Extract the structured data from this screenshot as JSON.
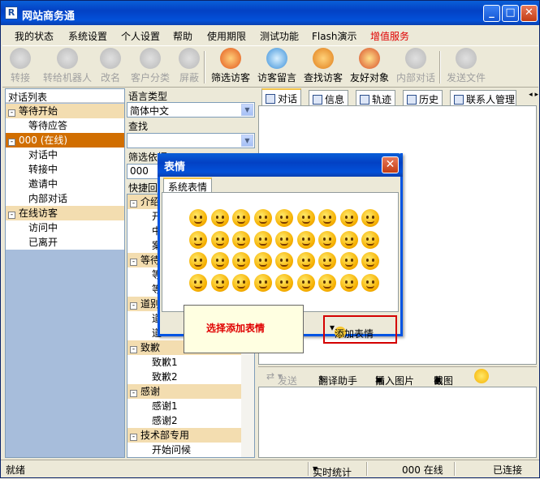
{
  "window": {
    "title": "网站商务通",
    "app_icon": "R"
  },
  "menu": [
    "我的状态",
    "系统设置",
    "个人设置",
    "帮助",
    "使用期限",
    "测试功能",
    "Flash演示",
    "增值服务"
  ],
  "menu_highlight_color": "#e00000",
  "toolbar": [
    {
      "label": "转接",
      "icon": "transfer-icon",
      "enabled": false
    },
    {
      "label": "转给机器人",
      "icon": "robot-icon",
      "enabled": false
    },
    {
      "label": "改名",
      "icon": "rename-icon",
      "enabled": false
    },
    {
      "label": "客户分类",
      "icon": "classify-icon",
      "enabled": false
    },
    {
      "label": "屏蔽",
      "icon": "block-icon",
      "enabled": false
    },
    {
      "label": "筛选访客",
      "icon": "filter-visitor-icon",
      "enabled": true
    },
    {
      "label": "访客留言",
      "icon": "visitor-message-icon",
      "enabled": true
    },
    {
      "label": "查找访客",
      "icon": "find-visitor-icon",
      "enabled": true
    },
    {
      "label": "友好对象",
      "icon": "friendly-object-icon",
      "enabled": true
    },
    {
      "label": "内部对话",
      "icon": "internal-chat-icon",
      "enabled": false
    },
    {
      "label": "发送文件",
      "icon": "send-file-icon",
      "enabled": false
    }
  ],
  "left": {
    "header": "对话列表",
    "tree": [
      {
        "label": "等待开始",
        "type": "group",
        "toggle": "-"
      },
      {
        "label": "等待应答",
        "type": "child"
      },
      {
        "label": "000 (在线)",
        "type": "selected",
        "toggle": "-"
      },
      {
        "label": "对话中",
        "type": "child"
      },
      {
        "label": "转接中",
        "type": "child"
      },
      {
        "label": "邀请中",
        "type": "child"
      },
      {
        "label": "内部对话",
        "type": "child"
      },
      {
        "label": "在线访客",
        "type": "group",
        "toggle": "-"
      },
      {
        "label": "访问中",
        "type": "child"
      },
      {
        "label": "已离开",
        "type": "child"
      }
    ]
  },
  "middle": {
    "lang_label": "语言类型",
    "lang_value": "简体中文",
    "find_label": "查找",
    "find_value": "",
    "filter_label": "筛选依据",
    "filter_value": "000",
    "quick_label": "快捷回",
    "quick": [
      {
        "label": "介绍",
        "type": "group"
      },
      {
        "label": "开",
        "type": "child"
      },
      {
        "label": "中",
        "type": "child"
      },
      {
        "label": "案",
        "type": "child"
      },
      {
        "label": "等待",
        "type": "group"
      },
      {
        "label": "等",
        "type": "child"
      },
      {
        "label": "等",
        "type": "child"
      },
      {
        "label": "道别",
        "type": "group"
      },
      {
        "label": "道",
        "type": "child"
      },
      {
        "label": "道",
        "type": "child"
      },
      {
        "label": "致歉",
        "type": "group"
      },
      {
        "label": "致歉1",
        "type": "child"
      },
      {
        "label": "致歉2",
        "type": "child"
      },
      {
        "label": "感谢",
        "type": "group"
      },
      {
        "label": "感谢1",
        "type": "child"
      },
      {
        "label": "感谢2",
        "type": "child"
      },
      {
        "label": "技术部专用",
        "type": "group"
      },
      {
        "label": "开始问候",
        "type": "child"
      }
    ]
  },
  "tabs": [
    "对话",
    "信息",
    "轨迹",
    "历史",
    "联系人管理"
  ],
  "tab_nav": "◂ ▸",
  "sendbar": {
    "send": "发送",
    "translate": "翻译助手",
    "insert_image": "插入图片",
    "screenshot": "截图"
  },
  "dialog": {
    "title": "表情",
    "tab": "系统表情",
    "emoticon_count": 40
  },
  "callout": "选择添加表情",
  "add_emoticon": "添加表情",
  "status": {
    "ready": "就绪",
    "realtime": "实时统计",
    "online": "000 在线",
    "connected": "已连接"
  }
}
